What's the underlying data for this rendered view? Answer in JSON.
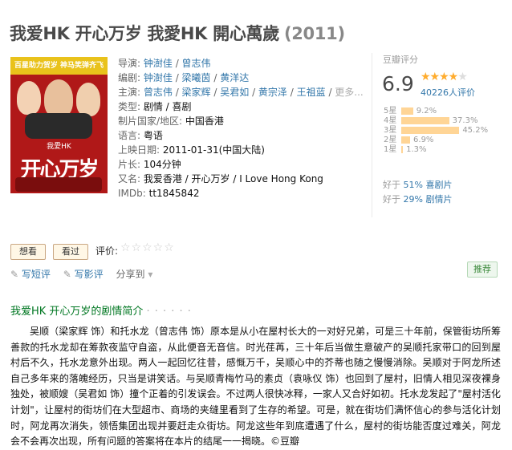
{
  "title": {
    "main": "我爱HK 开心万岁 我愛HK 開心萬歲",
    "year": "(2011)"
  },
  "poster": {
    "band_text": "百星助力贺岁  神马笑弹齐飞",
    "small_text": "我愛HK",
    "big_text": "开心万岁"
  },
  "info": {
    "director_label": "导演: ",
    "directors": [
      "钟澍佳",
      "曾志伟"
    ],
    "writer_label": "编剧: ",
    "writers": [
      "钟澍佳",
      "梁曦茵",
      "黄洋达"
    ],
    "cast_label": "主演: ",
    "cast": [
      "曾志伟",
      "梁家辉",
      "吴君如",
      "黄宗泽",
      "王祖蓝"
    ],
    "cast_more": "更多...",
    "genre_label": "类型: ",
    "genre": "剧情 / 喜剧",
    "region_label": "制片国家/地区: ",
    "region": "中国香港",
    "language_label": "语言: ",
    "language": "粤语",
    "release_label": "上映日期: ",
    "release": "2011-01-31(中国大陆)",
    "runtime_label": "片长: ",
    "runtime": "104分钟",
    "aka_label": "又名: ",
    "aka": "我爱香港 / 开心万岁 / I Love Hong Kong",
    "imdb_label": "IMDb: ",
    "imdb": "tt1845842"
  },
  "rating": {
    "header": "豆瓣评分",
    "score": "6.9",
    "stars_filled": "★★★★",
    "stars_empty": "★",
    "count_text": "40226人评价",
    "distribution": [
      {
        "label": "5星",
        "value": 9.2,
        "text": "9.2%"
      },
      {
        "label": "4星",
        "value": 37.3,
        "text": "37.3%"
      },
      {
        "label": "3星",
        "value": 45.2,
        "text": "45.2%"
      },
      {
        "label": "2星",
        "value": 6.9,
        "text": "6.9%"
      },
      {
        "label": "1星",
        "value": 1.3,
        "text": "1.3%"
      }
    ],
    "better_prefix": "好于 ",
    "better1_pct": "51%",
    "better1_cat": " 喜剧片",
    "better2_pct": "29%",
    "better2_cat": " 剧情片"
  },
  "buttons": {
    "want": "想看",
    "seen": "看过",
    "eval_label": "评价:",
    "eval_stars": "☆☆☆☆☆"
  },
  "actions": {
    "short_review": "写短评",
    "review": "写影评",
    "share": "分享到",
    "share_arrow": "▾",
    "recommend": "推荐"
  },
  "synopsis": {
    "heading": "我爱HK 开心万岁的剧情简介",
    "dots": "· · · · · ·",
    "text": "吴顺（梁家辉 饰）和托水龙（曾志伟 饰）原本是从小在屋村长大的一对好兄弟，可是三十年前，保管街坊所筹善款的托水龙却在筹款夜监守自盗，从此便音无音信。时光荏苒，三十年后当做生意破产的吴顺托家带口的回到屋村后不久，托水龙意外出现。两人一起回忆往昔，感慨万千，吴顺心中的芥蒂也随之慢慢消除。吴顺对于阿龙所述自己多年来的落魄经历，只当是讲笑话。与吴顺青梅竹马的素贞（袁咏仪 饰）也回到了屋村，旧情人相见深夜裸身独处，被顺嫂（吴君如 饰）撞个正着的引发误会。不过两人很快冰释，一家人又合好如初。托水龙发起了\"屋村活化计划\"，让屋村的街坊们在大型超市、商场的夹缝里看到了生存的希望。可是，就在街坊们满怀信心的参与活化计划时，阿龙再次消失，领悟集团出现并要赶走众街坊。阿龙这些年到底遭遇了什么，屋村的街坊能否度过难关，阿龙会不会再次出现，所有问题的答案将在本片的结尾一一揭晓。©豆瓣"
  }
}
